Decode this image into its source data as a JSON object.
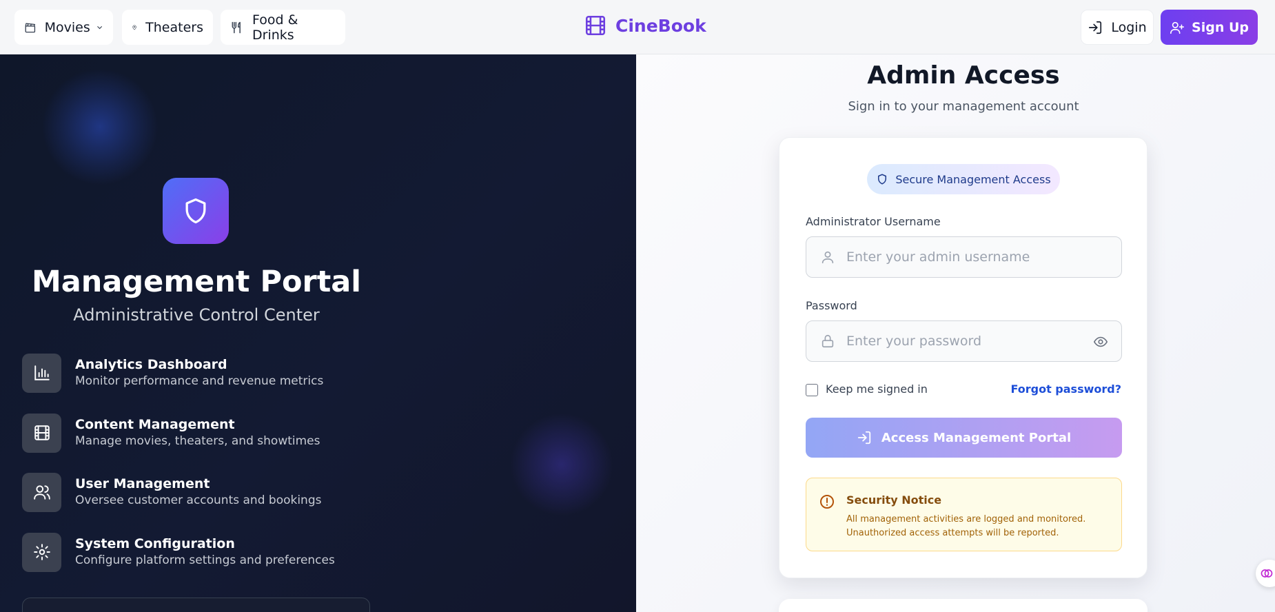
{
  "navbar": {
    "movies_label": "Movies",
    "theaters_label": "Theaters",
    "food_label": "Food & Drinks",
    "brand": "CineBook",
    "login_label": "Login",
    "signup_label": "Sign Up"
  },
  "left": {
    "title": "Management Portal",
    "subtitle": "Administrative Control Center",
    "features": [
      {
        "title": "Analytics Dashboard",
        "desc": "Monitor performance and revenue metrics",
        "icon": "bar-chart-icon"
      },
      {
        "title": "Content Management",
        "desc": "Manage movies, theaters, and showtimes",
        "icon": "film-icon"
      },
      {
        "title": "User Management",
        "desc": "Oversee customer accounts and bookings",
        "icon": "users-icon"
      },
      {
        "title": "System Configuration",
        "desc": "Configure platform settings and preferences",
        "icon": "gear-icon"
      }
    ]
  },
  "form": {
    "title": "Admin Access",
    "subtitle": "Sign in to your management account",
    "badge": "Secure Management Access",
    "username_label": "Administrator Username",
    "username_placeholder": "Enter your admin username",
    "password_label": "Password",
    "password_placeholder": "Enter your password",
    "keep_signed_in": "Keep me signed in",
    "forgot": "Forgot password?",
    "submit": "Access Management Portal",
    "notice_title": "Security Notice",
    "notice_line1": "All management activities are logged and monitored.",
    "notice_line2": "Unauthorized access attempts will be reported."
  },
  "colors": {
    "brand": "#6d3fe0",
    "panel_dark": "#0f172a",
    "accent_blue": "#1d4ed8",
    "notice_bg": "#fefce8"
  }
}
